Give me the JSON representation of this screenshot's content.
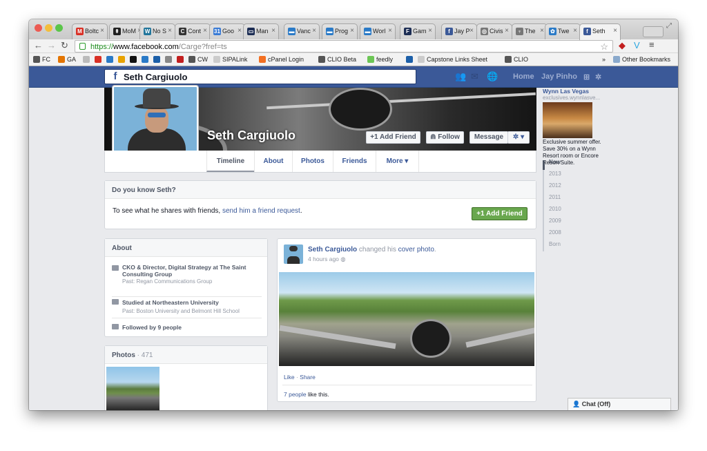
{
  "browser": {
    "tabs": [
      {
        "label": "Boltc",
        "favicon": "M",
        "color": "#d93025"
      },
      {
        "label": "MoM",
        "favicon": "⇞",
        "color": "#222"
      },
      {
        "label": "No S",
        "favicon": "W",
        "color": "#21759b"
      },
      {
        "label": "Cont",
        "favicon": "C",
        "color": "#333"
      },
      {
        "label": "Goo",
        "favicon": "31",
        "color": "#3a7bd5"
      },
      {
        "label": "Man",
        "favicon": "▭",
        "color": "#1c2d54"
      },
      {
        "label": "Vanc",
        "favicon": "▬",
        "color": "#2a7ac7"
      },
      {
        "label": "Prog",
        "favicon": "▬",
        "color": "#2a7ac7"
      },
      {
        "label": "Worl",
        "favicon": "▬",
        "color": "#2a7ac7"
      },
      {
        "label": "Gam",
        "favicon": "F",
        "color": "#1c2d54"
      },
      {
        "label": "Jay P",
        "favicon": "f",
        "color": "#3b5998"
      },
      {
        "label": "Civis",
        "favicon": "◎",
        "color": "#777"
      },
      {
        "label": "The",
        "favicon": "♆",
        "color": "#777"
      },
      {
        "label": "Twe",
        "favicon": "✿",
        "color": "#2a7ac7"
      },
      {
        "label": "Seth",
        "favicon": "f",
        "color": "#3b5998"
      }
    ],
    "url": {
      "scheme": "https://",
      "host": "www.facebook.com",
      "path": "/Carge?fref=ts"
    },
    "bookmarks": [
      {
        "label": "FC",
        "color": "#555"
      },
      {
        "label": "GA",
        "color": "#e37400"
      },
      {
        "label": "",
        "color": "#bbb"
      },
      {
        "label": "",
        "color": "#d93025"
      },
      {
        "label": "",
        "color": "#2a7ac7"
      },
      {
        "label": "",
        "color": "#e8a200"
      },
      {
        "label": "",
        "color": "#111"
      },
      {
        "label": "",
        "color": "#2a7ac7"
      },
      {
        "label": "",
        "color": "#1c5fa8"
      },
      {
        "label": "",
        "color": "#888"
      },
      {
        "label": "",
        "color": "#c21f1f"
      },
      {
        "label": "CW",
        "color": "#555"
      },
      {
        "label": "SIPALink",
        "color": "#ccc"
      },
      {
        "label": "cPanel Login",
        "color": "#f36f21"
      },
      {
        "label": "CLIO Beta",
        "color": "#555"
      },
      {
        "label": "feedly",
        "color": "#6cc655"
      },
      {
        "label": "",
        "color": "#1c5fa8"
      },
      {
        "label": "Capstone Links Sheet",
        "color": "#ccc"
      },
      {
        "label": "CLIO",
        "color": "#555"
      }
    ],
    "overflow": "»",
    "other_bookmarks": "Other Bookmarks"
  },
  "fb": {
    "search_value": "Seth Cargiuolo",
    "nav": {
      "home": "Home",
      "user": "Jay Pinho"
    },
    "profile": {
      "name": "Seth Cargiuolo",
      "add_friend": "+1 Add Friend",
      "follow": "⋒ Follow",
      "message": "Message",
      "gear": "✲ ▾",
      "tabs": [
        "Timeline",
        "About",
        "Photos",
        "Friends",
        "More ▾"
      ]
    },
    "know": {
      "title": "Do you know Seth?",
      "text": "To see what he shares with friends, ",
      "link": "send him a friend request",
      "end": ".",
      "button": "+1 Add Friend"
    },
    "about": {
      "title": "About",
      "job_prefix": "CKO & Director, Digital Strategy at ",
      "job_org": "The Saint Consulting Group",
      "job_past": "Past: Regan Communications Group",
      "edu_prefix": "Studied at ",
      "edu_org": "Northeastern University",
      "edu_past": "Past: Boston University and Belmont Hill School",
      "followed_prefix": "Followed by ",
      "followed_link": "9 people"
    },
    "photos": {
      "title": "Photos",
      "count": "· 471"
    },
    "post": {
      "author": "Seth Cargiuolo",
      "action": " changed his ",
      "object": "cover photo",
      "end": ".",
      "time": "4 hours ago",
      "like": "Like",
      "sep": " · ",
      "share": "Share",
      "likes_link": "7 people",
      "likes_rest": " like this."
    },
    "ad": {
      "title": "Wynn Las Vegas",
      "domain": "exclusives.wynnlasve...",
      "body": "Exclusive summer offer. Save 30% on a Wynn Resort room or Encore Resort Suite."
    },
    "years": [
      "Now",
      "2013",
      "2012",
      "2011",
      "2010",
      "2009",
      "2008",
      "Born"
    ],
    "chat": "Chat (Off)"
  }
}
